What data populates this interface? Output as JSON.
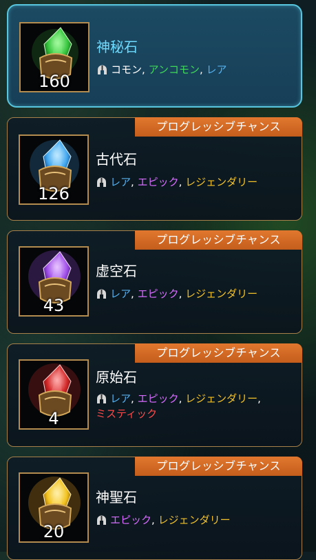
{
  "chance_label": "プログレッシブチャンス",
  "shards": [
    {
      "name": "神秘石",
      "count": "160",
      "gem_color": "#36c63e",
      "rarities": [
        {
          "label": "コモン",
          "color": "#ffffff"
        },
        {
          "label": "アンコモン",
          "color": "#40d85a"
        },
        {
          "label": "レア",
          "color": "#56b2f0"
        }
      ]
    },
    {
      "name": "古代石",
      "count": "126",
      "gem_color": "#42a8f0",
      "rarities": [
        {
          "label": "レア",
          "color": "#56b2f0"
        },
        {
          "label": "エピック",
          "color": "#d76cff"
        },
        {
          "label": "レジェンダリー",
          "color": "#f3c22a"
        }
      ]
    },
    {
      "name": "虚空石",
      "count": "43",
      "gem_color": "#a050e8",
      "rarities": [
        {
          "label": "レア",
          "color": "#56b2f0"
        },
        {
          "label": "エピック",
          "color": "#d76cff"
        },
        {
          "label": "レジェンダリー",
          "color": "#f3c22a"
        }
      ]
    },
    {
      "name": "原始石",
      "count": "4",
      "gem_color": "#d42a2a",
      "rarities": [
        {
          "label": "レア",
          "color": "#56b2f0"
        },
        {
          "label": "エピック",
          "color": "#d76cff"
        },
        {
          "label": "レジェンダリー",
          "color": "#f3c22a"
        },
        {
          "label": "ミスティック",
          "color": "#ff4a4a"
        }
      ]
    },
    {
      "name": "神聖石",
      "count": "20",
      "gem_color": "#f2c21e",
      "rarities": [
        {
          "label": "エピック",
          "color": "#d76cff"
        },
        {
          "label": "レジェンダリー",
          "color": "#f3c22a"
        }
      ]
    }
  ],
  "icons": {
    "rarity_icon": "helmet-icon"
  }
}
